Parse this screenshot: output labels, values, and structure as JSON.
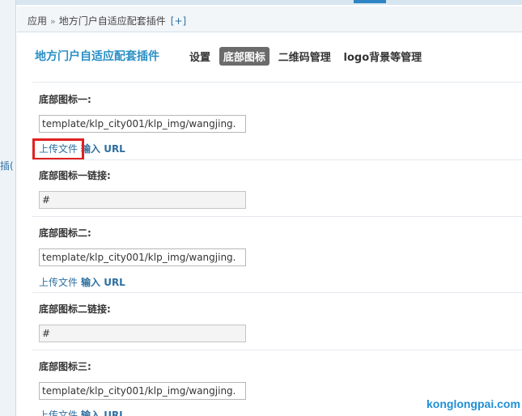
{
  "breadcrumb": {
    "app": "应用",
    "separator": "»",
    "plugin": "地方门户自适应配套插件",
    "add": "[+]"
  },
  "left_fragment": "插(",
  "plugin_title": "地方门户自适应配套插件",
  "tabs": [
    {
      "label": "设置",
      "active": false
    },
    {
      "label": "底部图标",
      "active": true
    },
    {
      "label": "二维码管理",
      "active": false
    },
    {
      "label": "logo背景等管理",
      "active": false
    }
  ],
  "fields": {
    "icon1": {
      "label": "底部图标一:",
      "value": "template/klp_city001/klp_img/wangjing."
    },
    "icon1_link": {
      "label": "底部图标一链接:",
      "value": "#"
    },
    "icon2": {
      "label": "底部图标二:",
      "value": "template/klp_city001/klp_img/wangjing."
    },
    "icon2_link": {
      "label": "底部图标二链接:",
      "value": "#"
    },
    "icon3": {
      "label": "底部图标三:",
      "value": "template/klp_city001/klp_img/wangjing."
    }
  },
  "upload_label": "上传文件",
  "url_label": "输入 URL",
  "watermark": "konglongpai.com",
  "colors": {
    "accent": "#2a8fc4",
    "link": "#2e6fa0",
    "highlight": "#e02020",
    "active_tab_bg": "#6b6b6b"
  }
}
